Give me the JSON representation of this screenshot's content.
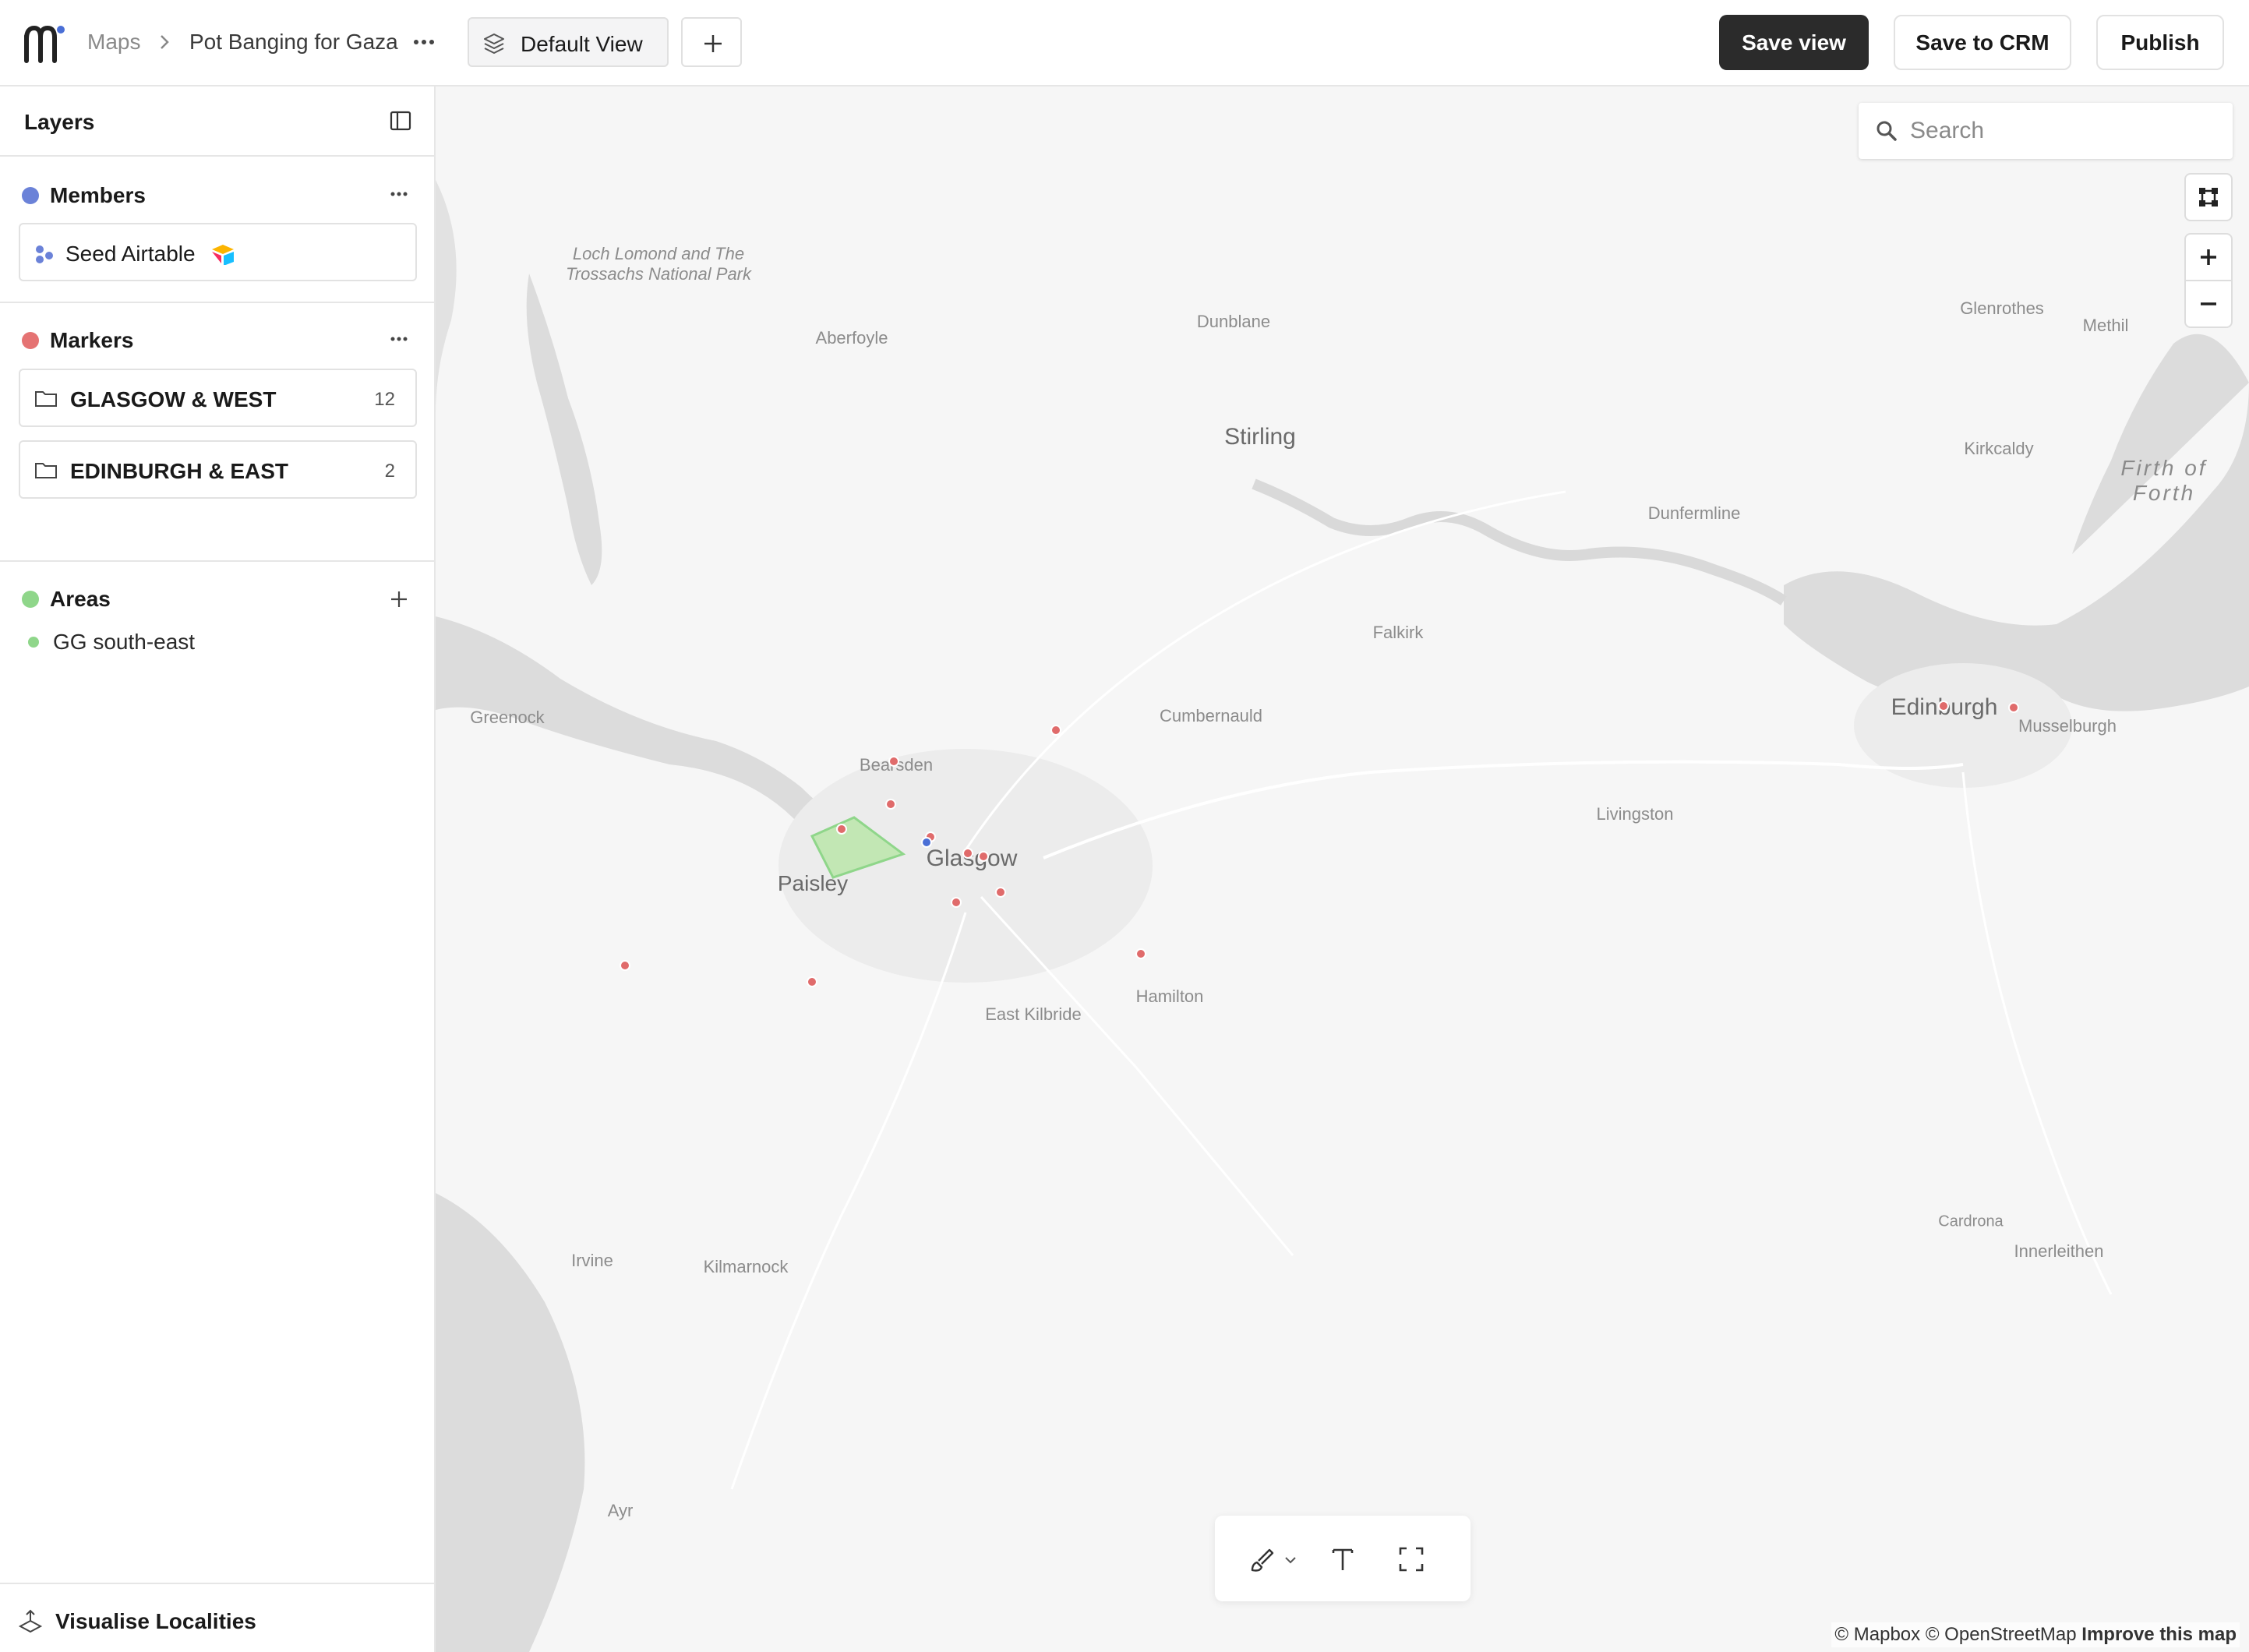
{
  "header": {
    "breadcrumb_root": "Maps",
    "map_title": "Pot Banging for Gaza",
    "view_tab_label": "Default View",
    "save_view_label": "Save view",
    "save_crm_label": "Save to CRM",
    "publish_label": "Publish"
  },
  "sidebar": {
    "title": "Layers",
    "members": {
      "title": "Members",
      "color": "#6b82d8",
      "source_label": "Seed Airtable"
    },
    "markers": {
      "title": "Markers",
      "color": "#e57373",
      "folders": [
        {
          "label": "GLASGOW & WEST",
          "count": "12"
        },
        {
          "label": "EDINBURGH & EAST",
          "count": "2"
        }
      ]
    },
    "areas": {
      "title": "Areas",
      "color": "#8fd68a",
      "items": [
        {
          "label": "GG south-east"
        }
      ]
    },
    "footer_label": "Visualise Localities"
  },
  "map": {
    "search_placeholder": "Search",
    "attribution_prefix": "© Mapbox © OpenStreetMap",
    "attribution_link": "Improve this map",
    "marker_color": "#e06b6b",
    "member_color": "#4a6fd6",
    "area_fill": "#b8e6a6",
    "places": {
      "loch_lomond": "Loch Lomond and The\nTrossachs National Park",
      "aberfoyle": "Aberfoyle",
      "dunblane": "Dunblane",
      "stirling": "Stirling",
      "glenrothes": "Glenrothes",
      "methil": "Methil",
      "kirkcaldy": "Kirkcaldy",
      "firth_of_forth": "Firth of\nForth",
      "dunfermline": "Dunfermline",
      "falkirk": "Falkirk",
      "greenock": "Greenock",
      "cumbernauld": "Cumbernauld",
      "edinburgh": "Edinburgh",
      "musselburgh": "Musselburgh",
      "bearsden": "Bearsden",
      "livingston": "Livingston",
      "glasgow": "Glasgow",
      "paisley": "Paisley",
      "hamilton": "Hamilton",
      "east_kilbride": "East Kilbride",
      "cardrona": "Cardrona",
      "innerleithen": "Innerleithen",
      "irvine": "Irvine",
      "kilmarnock": "Kilmarnock",
      "ayr": "Ayr"
    }
  }
}
